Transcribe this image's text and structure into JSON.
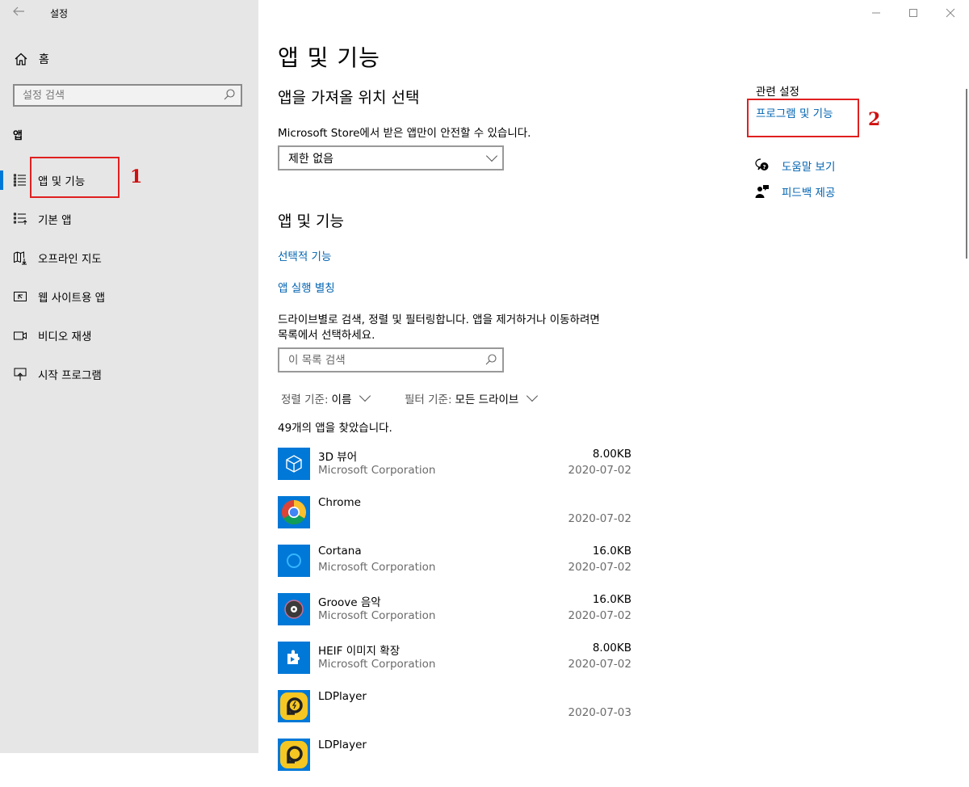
{
  "window": {
    "title": "설정",
    "controls": [
      "minimize",
      "maximize",
      "close"
    ]
  },
  "sidebar": {
    "home_label": "홈",
    "search_placeholder": "설정 검색",
    "section_label": "앱",
    "items": [
      {
        "label": "앱 및 기능",
        "icon": "apps-features-icon",
        "active": true
      },
      {
        "label": "기본 앱",
        "icon": "default-apps-icon",
        "active": false
      },
      {
        "label": "오프라인 지도",
        "icon": "offline-maps-icon",
        "active": false
      },
      {
        "label": "웹 사이트용 앱",
        "icon": "apps-for-websites-icon",
        "active": false
      },
      {
        "label": "비디오 재생",
        "icon": "video-playback-icon",
        "active": false
      },
      {
        "label": "시작 프로그램",
        "icon": "startup-icon",
        "active": false
      }
    ]
  },
  "main": {
    "page_title": "앱 및 기능",
    "install_section": {
      "heading": "앱을 가져올 위치 선택",
      "description": "Microsoft Store에서 받은 앱만이 안전할 수 있습니다.",
      "dropdown_value": "제한 없음"
    },
    "apps_section": {
      "heading": "앱 및 기능",
      "links": [
        "선택적 기능",
        "앱 실행 별칭"
      ],
      "description_line1": "드라이브별로 검색, 정렬 및 필터링합니다. 앱을 제거하거나 이동하려면",
      "description_line2": "목록에서 선택하세요.",
      "search_placeholder": "이 목록 검색",
      "sort_label": "정렬 기준:",
      "sort_value": "이름",
      "filter_label": "필터 기준:",
      "filter_value": "모든 드라이브",
      "count_text": "49개의 앱을 찾았습니다.",
      "apps": [
        {
          "name": "3D 뷰어",
          "publisher": "Microsoft Corporation",
          "size": "8.00KB",
          "date": "2020-07-02",
          "icon": "3d-viewer-icon"
        },
        {
          "name": "Chrome",
          "publisher": "",
          "size": "",
          "date": "2020-07-02",
          "icon": "chrome-icon"
        },
        {
          "name": "Cortana",
          "publisher": "Microsoft Corporation",
          "size": "16.0KB",
          "date": "2020-07-02",
          "icon": "cortana-icon"
        },
        {
          "name": "Groove 음악",
          "publisher": "Microsoft Corporation",
          "size": "16.0KB",
          "date": "2020-07-02",
          "icon": "groove-music-icon"
        },
        {
          "name": "HEIF 이미지 확장",
          "publisher": "Microsoft Corporation",
          "size": "8.00KB",
          "date": "2020-07-02",
          "icon": "heif-extension-icon"
        },
        {
          "name": "LDPlayer",
          "publisher": "",
          "size": "",
          "date": "2020-07-03",
          "icon": "ldplayer-icon"
        },
        {
          "name": "LDPlayer",
          "publisher": "",
          "size": "",
          "date": "",
          "icon": "ldplayer-icon"
        }
      ]
    }
  },
  "related": {
    "heading": "관련 설정",
    "programs_link": "프로그램 및 기능",
    "help_link": "도움말 보기",
    "feedback_link": "피드백 제공"
  },
  "annotations": {
    "box1_number": "1",
    "box2_number": "2",
    "color": "#e02020"
  },
  "colors": {
    "accent": "#0078d7",
    "link": "#0063b1",
    "sidebar_bg": "#e6e6e6"
  }
}
